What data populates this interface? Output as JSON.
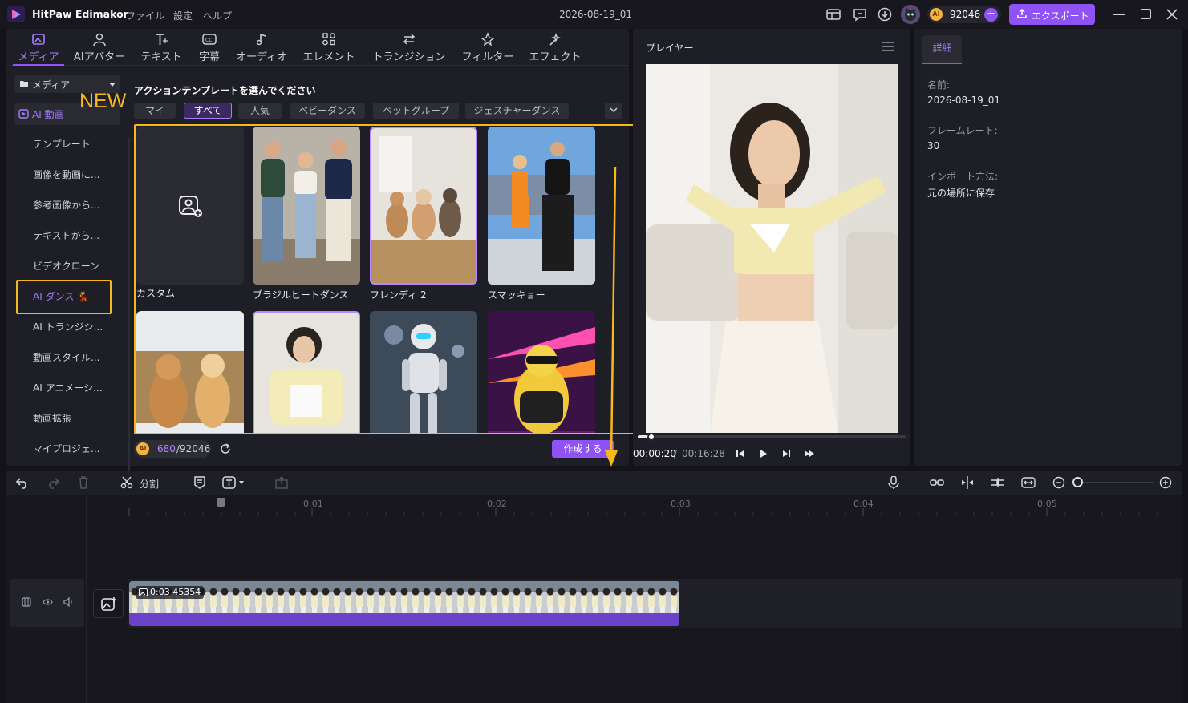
{
  "app": {
    "name": "HitPaw Edimakor",
    "menu": [
      "ファイル",
      "設定",
      "ヘルプ"
    ],
    "document_title": "2026-08-19_01",
    "credits": "92046",
    "coin_label": "AI",
    "export_label": "エクスポート"
  },
  "tabs": [
    {
      "label": "メディア",
      "icon": "media-icon",
      "active": true
    },
    {
      "label": "AIアバター",
      "icon": "avatar-icon",
      "active": false
    },
    {
      "label": "テキスト",
      "icon": "text-icon",
      "active": false
    },
    {
      "label": "字幕",
      "icon": "subtitle-icon",
      "active": false
    },
    {
      "label": "オーディオ",
      "icon": "music-note-icon",
      "active": false
    },
    {
      "label": "エレメント",
      "icon": "elements-icon",
      "active": false
    },
    {
      "label": "トランジション",
      "icon": "transition-icon",
      "active": false
    },
    {
      "label": "フィルター",
      "icon": "filter-icon",
      "active": false
    },
    {
      "label": "エフェクト",
      "icon": "effect-icon",
      "active": false
    }
  ],
  "sidebar": {
    "media_select": "メディア",
    "ai_video": "AI 動画",
    "new_badge": "NEW",
    "items": [
      "テンプレート",
      "画像を動画に...",
      "参考画像から...",
      "テキストから...",
      "ビデオクローン",
      "AI ダンス 💃",
      "AI トランジシ...",
      "動画スタイル...",
      "AI アニメーシ...",
      "動画拡張",
      "マイプロジェ..."
    ]
  },
  "content": {
    "title": "アクションテンプレートを選んでください",
    "chips": [
      "マイ",
      "すべて",
      "人気",
      "ベビーダンス",
      "ペットグループ",
      "ジェスチャーダンス"
    ],
    "active_chip": "すべて",
    "cards": [
      "カスタム",
      "ブラジルヒートダンス",
      "フレンディ 2",
      "スマッキョー"
    ],
    "coins_used": "680",
    "coins_total": "/92046",
    "create_label": "作成する"
  },
  "player": {
    "title": "プレイヤー",
    "current_time": "00:00:20",
    "separator": "/",
    "total_time": "00:16:28",
    "progress": 0.02
  },
  "details": {
    "tab": "詳細",
    "fields": [
      {
        "label": "名前:",
        "value": "2026-08-19_01"
      },
      {
        "label": "フレームレート:",
        "value": "30"
      },
      {
        "label": "インポート方法:",
        "value": "元の場所に保存"
      }
    ]
  },
  "timeline": {
    "split_label": "分割",
    "ticks": [
      "0:01",
      "0:02",
      "0:03",
      "0:04",
      "0:05"
    ],
    "clip_label": "0:03 45354"
  },
  "colors": {
    "accent": "#8e52f5",
    "highlight": "#f6b91b",
    "panel": "#1e1e26"
  }
}
